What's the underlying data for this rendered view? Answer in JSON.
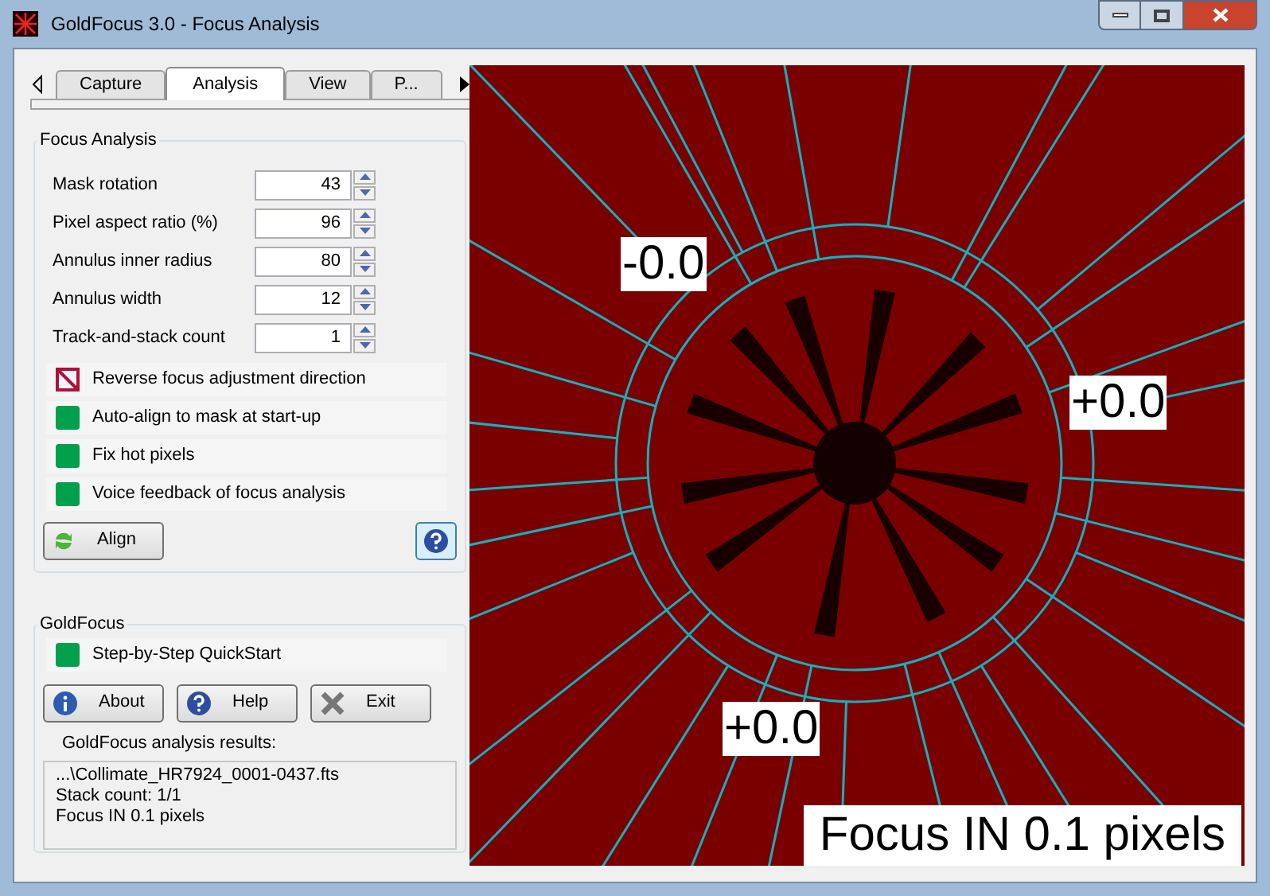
{
  "window": {
    "title": "GoldFocus 3.0 - Focus Analysis"
  },
  "tabs": [
    {
      "label": "Capture",
      "selected": false
    },
    {
      "label": "Analysis",
      "selected": true
    },
    {
      "label": "View",
      "selected": false
    },
    {
      "label": "P...",
      "selected": false
    }
  ],
  "focus_analysis": {
    "title": "Focus Analysis",
    "fields": [
      {
        "label": "Mask rotation",
        "value": "43"
      },
      {
        "label": "Pixel aspect ratio (%)",
        "value": "96"
      },
      {
        "label": "Annulus inner radius",
        "value": "80"
      },
      {
        "label": "Annulus width",
        "value": "12"
      },
      {
        "label": "Track-and-stack count",
        "value": "1"
      }
    ],
    "options": [
      {
        "label": "Reverse focus adjustment direction",
        "checked": false
      },
      {
        "label": "Auto-align to mask at start-up",
        "checked": true
      },
      {
        "label": "Fix hot pixels",
        "checked": true
      },
      {
        "label": "Voice feedback of focus analysis",
        "checked": true
      }
    ],
    "align_button": "Align"
  },
  "goldfocus": {
    "title": "GoldFocus",
    "options": [
      {
        "label": "Step-by-Step QuickStart",
        "checked": true
      }
    ],
    "buttons": [
      {
        "label": "About",
        "kind": "info"
      },
      {
        "label": "Help",
        "kind": "help"
      },
      {
        "label": "Exit",
        "kind": "exit"
      }
    ],
    "results_label": "GoldFocus analysis results:",
    "results": [
      "...\\Collimate_HR7924_0001-0437.fts",
      "Stack count: 1/1",
      "Focus IN 0.1 pixels"
    ]
  },
  "image": {
    "labels": [
      "-0.0",
      "+0.0",
      "+0.0"
    ],
    "caption": "Focus IN 0.1 pixels"
  }
}
